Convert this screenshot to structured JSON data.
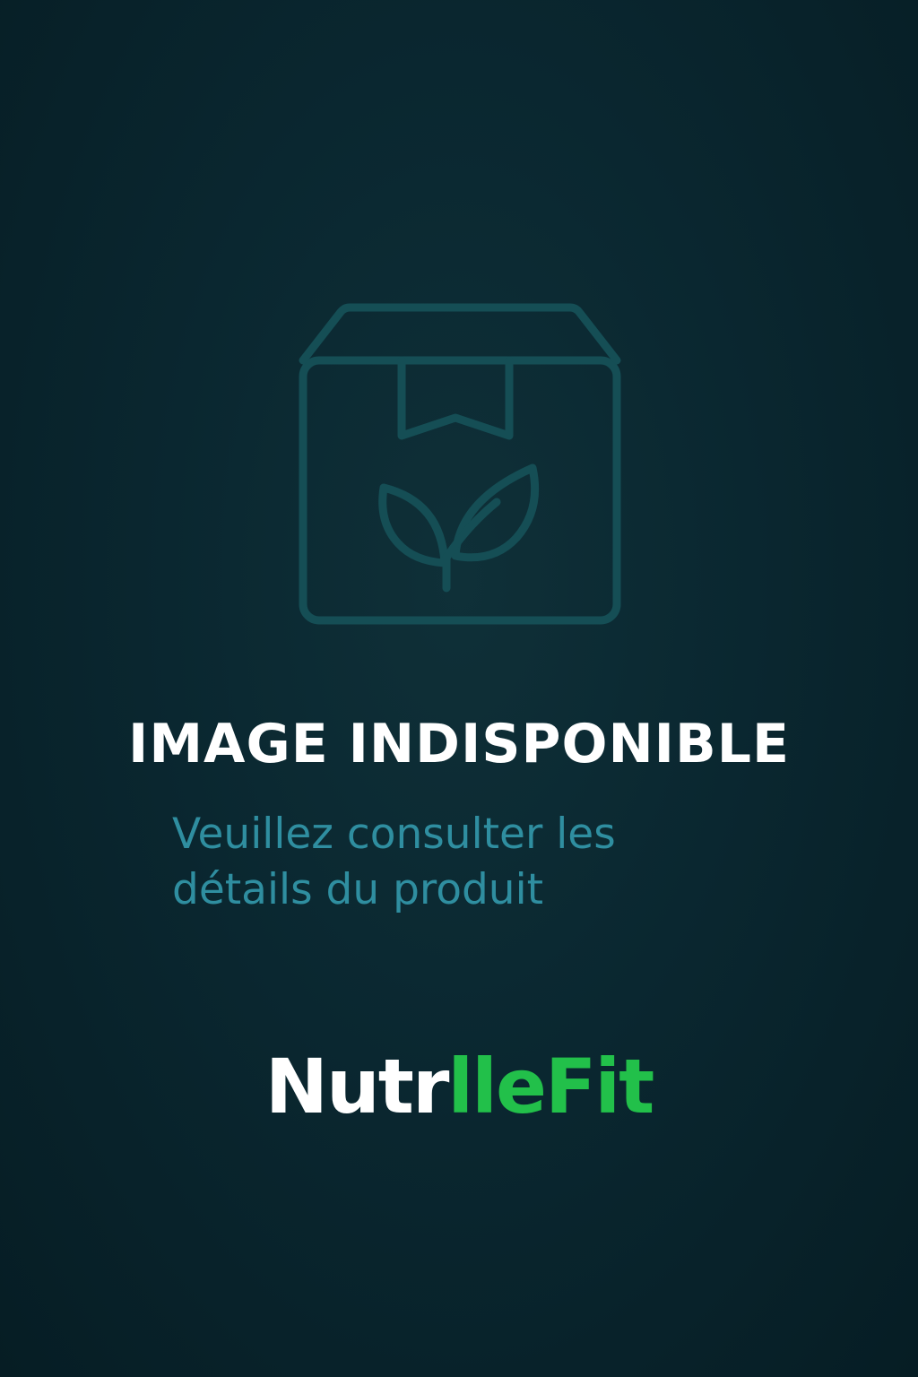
{
  "placeholder": {
    "icon": "box-with-leaf-icon",
    "icon_color": "#154e55",
    "headline": "IMAGE INDISPONIBLE",
    "subtext_line1": "Veuillez consulter les",
    "subtext_line2": "détails du produit",
    "subtext_color": "#2f8ea0"
  },
  "brand": {
    "part1": "Nutr",
    "part2": "lleFit",
    "part1_color": "#ffffff",
    "part2_color": "#22c04a"
  },
  "background_color": "#0a2730"
}
